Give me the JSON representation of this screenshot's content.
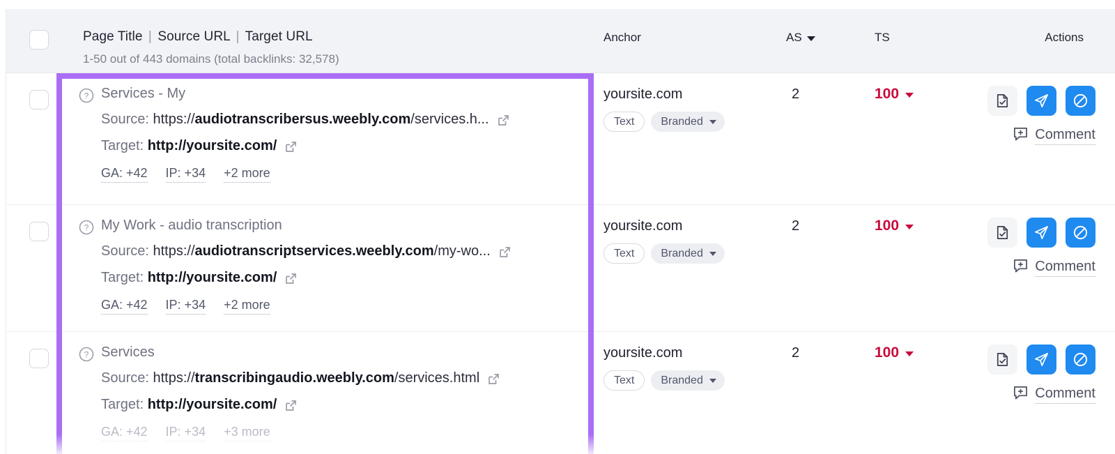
{
  "header": {
    "title_parts": [
      "Page Title",
      "Source URL",
      "Target URL"
    ],
    "title_p1": "Page Title",
    "title_p2": "Source URL",
    "title_p3": "Target URL",
    "separator": "|",
    "subtitle": "1-50 out of 443 domains (total backlinks: 32,578)",
    "col_anchor": "Anchor",
    "col_as": "AS",
    "col_ts": "TS",
    "col_actions": "Actions"
  },
  "labels": {
    "source": "Source:",
    "target": "Target:",
    "protocol_https": "https://",
    "comment": "Comment"
  },
  "colors": {
    "highlight": "#a96ef5",
    "action_blue": "#1f8af0",
    "ts_red": "#c9093c",
    "header_bg": "#f2f3f7"
  },
  "rows": [
    {
      "title": "Services - My",
      "source_proto": "https://",
      "source_domain": "audiotranscribersus.weebly.com",
      "source_path": "/services.h...",
      "target_url": "http://yoursite.com/",
      "meta": [
        "GA: +42",
        "IP: +34",
        "+2 more"
      ],
      "anchor": "yoursite.com",
      "chip_type": "Text",
      "chip_category": "Branded",
      "as": "2",
      "ts": "100",
      "comment": "Comment"
    },
    {
      "title": "My Work - audio transcription",
      "source_proto": "https://",
      "source_domain": "audiotranscriptservices.weebly.com",
      "source_path": "/my-wo...",
      "target_url": "http://yoursite.com/",
      "meta": [
        "GA: +42",
        "IP: +34",
        "+2 more"
      ],
      "anchor": "yoursite.com",
      "chip_type": "Text",
      "chip_category": "Branded",
      "as": "2",
      "ts": "100",
      "comment": "Comment"
    },
    {
      "title": "Services",
      "source_proto": "https://",
      "source_domain": "transcribingaudio.weebly.com",
      "source_path": "/services.html",
      "target_url": "http://yoursite.com/",
      "meta": [
        "GA: +42",
        "IP: +34",
        "+3 more"
      ],
      "anchor": "yoursite.com",
      "chip_type": "Text",
      "chip_category": "Branded",
      "as": "2",
      "ts": "100",
      "comment": "Comment"
    }
  ],
  "icons": {
    "help": "question-mark-circle",
    "external": "external-link",
    "report": "document-check",
    "send": "paper-plane",
    "disavow": "block-circle",
    "comment": "comment-plus"
  }
}
